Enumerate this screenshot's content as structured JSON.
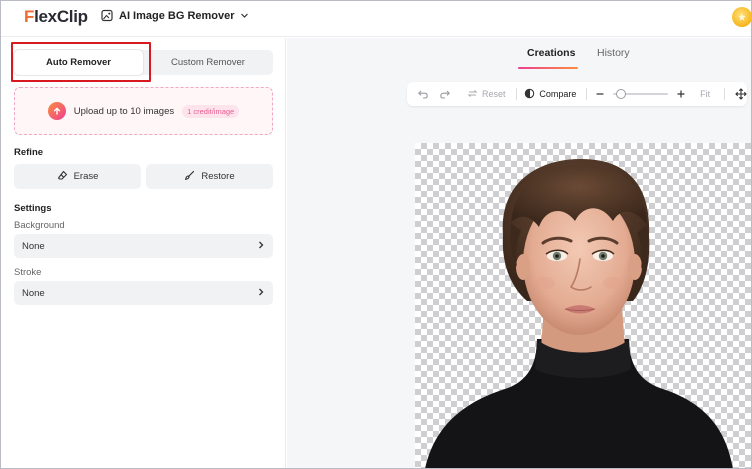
{
  "header": {
    "logo_first": "F",
    "logo_rest": "lexClip",
    "tool_name": "AI Image BG Remover",
    "tool_icon": "image-sparkle-icon",
    "dropdown_icon": "chevron-down-icon",
    "avatar_icon": "coin-icon"
  },
  "left_panel": {
    "modes": {
      "auto": "Auto Remover",
      "custom": "Custom Remover",
      "selected": "Auto Remover"
    },
    "upload": {
      "label": "Upload up to 10 images",
      "credit_badge": "1 credit/image",
      "icon": "upload-arrow-icon"
    },
    "refine": {
      "title": "Refine",
      "erase_label": "Erase",
      "restore_label": "Restore"
    },
    "settings": {
      "title": "Settings",
      "background_label": "Background",
      "background_value": "None",
      "stroke_label": "Stroke",
      "stroke_value": "None"
    }
  },
  "right_panel": {
    "tabs": [
      {
        "label": "Creations",
        "active": true
      },
      {
        "label": "History",
        "active": false
      }
    ],
    "toolbar": {
      "reset_label": "Reset",
      "compare_label": "Compare",
      "fit_label": "Fit",
      "zoom_level": 0.05
    },
    "canvas": {
      "content": "portrait-cutout-image",
      "background": "transparent-checkerboard"
    }
  },
  "colors": {
    "brand_orange": "#ef6b2e",
    "brand_pink": "#ed3f8f",
    "highlight_red": "#d71920"
  }
}
